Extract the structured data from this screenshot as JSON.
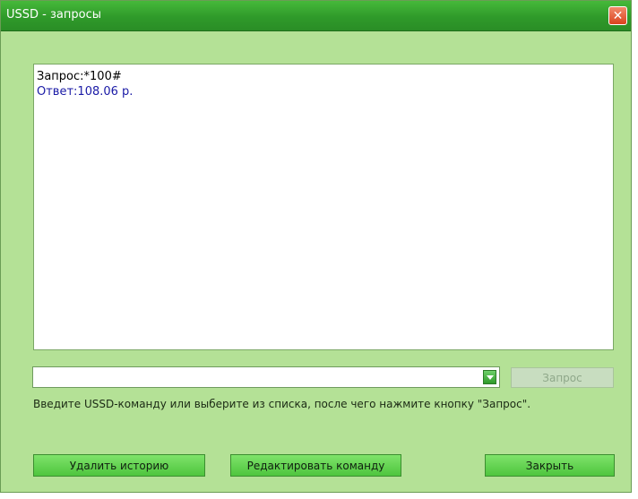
{
  "window": {
    "title": "USSD - запросы",
    "close_symbol": "✕"
  },
  "history": {
    "lines": [
      {
        "type": "request",
        "text": "Запрос:*100#"
      },
      {
        "type": "answer",
        "text": "Ответ:108.06 р."
      }
    ]
  },
  "command": {
    "value": "",
    "query_label": "Запрос"
  },
  "hint": "Введите USSD-команду или выберите из списка, после чего нажмите кнопку \"Запрос\".",
  "buttons": {
    "delete_history": "Удалить историю",
    "edit_command": "Редактировать команду",
    "close": "Закрыть"
  },
  "colors": {
    "window_bg": "#b4e196",
    "titlebar": "#2f9a2a",
    "answer_text": "#1a1aa6",
    "close_button": "#d9431d"
  },
  "icons": {
    "close": "close-icon",
    "dropdown": "chevron-down-icon"
  }
}
